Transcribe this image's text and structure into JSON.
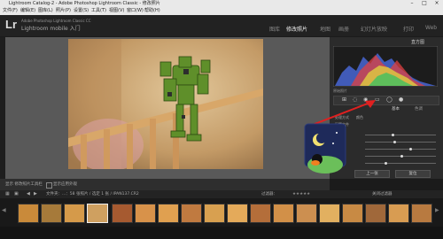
{
  "window": {
    "title": "Lightroom Catalog-2 - Adobe Photoshop Lightroom Classic - 修改照片"
  },
  "menu": [
    "文件(F)",
    "编辑(E)",
    "图库(L)",
    "照片(P)",
    "设置(S)",
    "工具(T)",
    "视图(V)",
    "窗口(W)",
    "帮助(H)"
  ],
  "identity": {
    "logo": "Lr",
    "line1": "Adobe Photoshop Lightroom Classic CC",
    "line2": "Lightroom mobile 入门"
  },
  "modules": [
    "图库",
    "修改照片",
    "地图",
    "画册",
    "幻灯片放映",
    "打印",
    "Web"
  ],
  "right_panel": {
    "histogram_label": "直方图",
    "original_photo": "原始照片",
    "tabs": [
      "基本",
      "色调"
    ],
    "treatment": "处理方式",
    "profile": "配置文件",
    "preset_label": "颜色",
    "wb": "白平衡",
    "buttons": [
      "上一张",
      "复位"
    ]
  },
  "toolbar": {
    "soft_proofing": "显示 修改照片工具栏",
    "proof_label": "软打样",
    "soft_proof_checkbox": "显示应用外观"
  },
  "filmstrip": {
    "info": "文件夹：...：58 张照片 / 选定 1 张 / IPAN137.CR2",
    "filter_label": "过滤器：",
    "stars": "★★★★★",
    "filter_off": "关闭过滤器"
  },
  "colors": {
    "accent": "#e0a030",
    "panel": "#2b2b2b",
    "center": "#595959"
  }
}
